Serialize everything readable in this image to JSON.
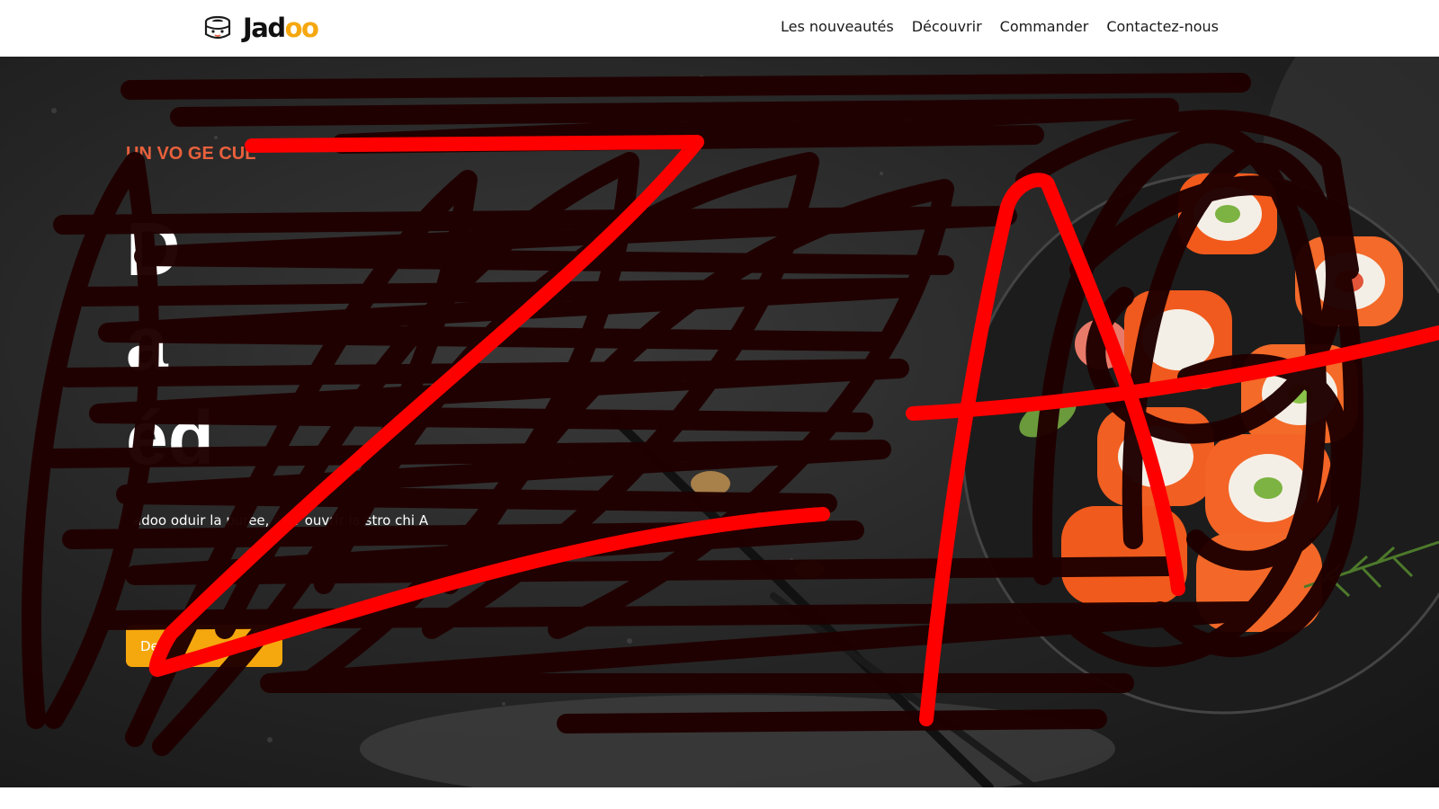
{
  "brand": {
    "name_main": "Jad",
    "name_accent": "oo",
    "logo_icon": "sushi-roll-icon"
  },
  "nav": {
    "items": [
      {
        "label": "Les nouveautés"
      },
      {
        "label": "Découvrir"
      },
      {
        "label": "Commander"
      },
      {
        "label": "Contactez-nous"
      }
    ]
  },
  "hero": {
    "tagline_fragments": [
      "UN VO",
      "GE CUL"
    ],
    "title_fragments": [
      "D",
      "a",
      "éd"
    ],
    "description_fragments": [
      "adoo",
      "oduir",
      "la",
      "puree,",
      "é",
      "ur",
      "ouvrir la",
      "stro",
      "chi",
      "A"
    ],
    "button_label_fragment": "De"
  },
  "colors": {
    "accent": "#f5a80e",
    "tagline": "#e8603c",
    "scribble_dark": "#200000",
    "scribble_red": "#ff0000"
  }
}
